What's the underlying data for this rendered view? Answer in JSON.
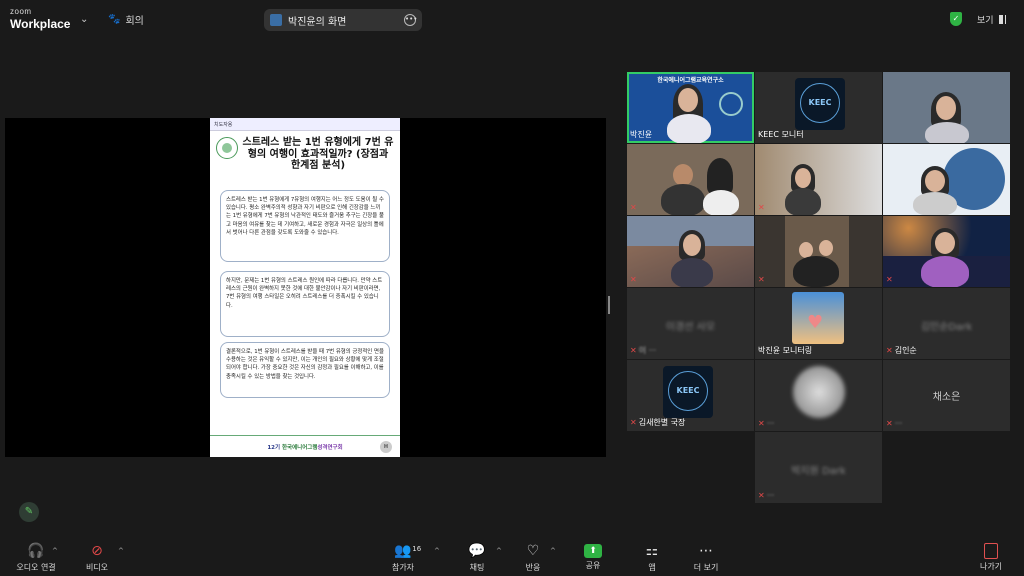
{
  "app": {
    "brand_top": "zoom",
    "brand_bottom": "Workplace"
  },
  "header": {
    "meeting_label": "회의",
    "share_title": "박진윤의 화면",
    "view_label": "보기"
  },
  "slide": {
    "header": "치도자용",
    "title": "스트레스 받는 1번 유형에게 7번 유형의 여행이 효과적일까? (장점과 한계점 분석)",
    "para1": "스트레스 받는 1번 유형에게 7유형의 여행지는 어느 정도 도움이 될 수 있습니다. 평소 완벽주의적 성향과 자기 비판으로 인해 긴장감을 느끼는 1번 유형에게 7번 유형의 낙관적인 태도와 즐거움 추구는 긴장을 풀고 마음의 여유를 찾는 데 기여하고, 새로운 경험과 자극은 일상의 틀에서 벗어나 다른 관점을 갖도록 도와줄 수 있습니다.",
    "para2": "하지만, 문제는 1번 유형의 스트레스 원인에 따라 다릅니다. 만약 스트레스의 근원이 완벽하지 못한 것에 대한 불안감이나 자기 비판이라면, 7번 유형의 여행 스타일은 오히려 스트레스를 더 증폭시킬 수 있습니다.",
    "para3": "결론적으로, 1번 유형이 스트레스를 받을 때 7번 유형의 긍정적인 면을 수용하는 것은 유익할 수 있지만, 이는 개인의 필요와 상황에 맞게 조절되어야 합니다. 가장 중요한 것은 자신의 감정과 필요를 이해하고, 이를 충족시킬 수 있는 방법을 찾는 것입니다.",
    "footer_prefix": "12기",
    "footer_org": "한국에니어그램",
    "footer_suffix": "성격연구회",
    "page_badge": "H"
  },
  "gallery": {
    "tiles": [
      {
        "name": "박진윤",
        "banner": "한국에니어그램교육연구소",
        "active": true
      },
      {
        "name": "KEEC 모니터"
      },
      {
        "name": ""
      },
      {
        "name": ""
      },
      {
        "name": ""
      },
      {
        "name": ""
      },
      {
        "name": ""
      },
      {
        "name": ""
      },
      {
        "name": ""
      },
      {
        "name": ""
      },
      {
        "name": "박진윤 모니터링"
      },
      {
        "name": "김인순"
      },
      {
        "name": "김새한별 국장"
      },
      {
        "name": ""
      },
      {
        "name": ""
      },
      {
        "name": ""
      }
    ],
    "blurred_names": [
      "이경선 사모",
      "김민순Dark",
      "박지원 Dark",
      "채소은"
    ],
    "big_name": "채소은",
    "keec_text": "KEEC"
  },
  "toolbar": {
    "audio": "오디오 연결",
    "video": "비디오",
    "participants": "참가자",
    "participant_count": "16",
    "chat": "채팅",
    "react": "반응",
    "share": "공유",
    "apps": "앱",
    "more": "더 보기",
    "leave": "나가기"
  },
  "colors": {
    "active_speaker": "#33cc66",
    "share_green": "#2fb344",
    "muted_red": "#e04848"
  }
}
